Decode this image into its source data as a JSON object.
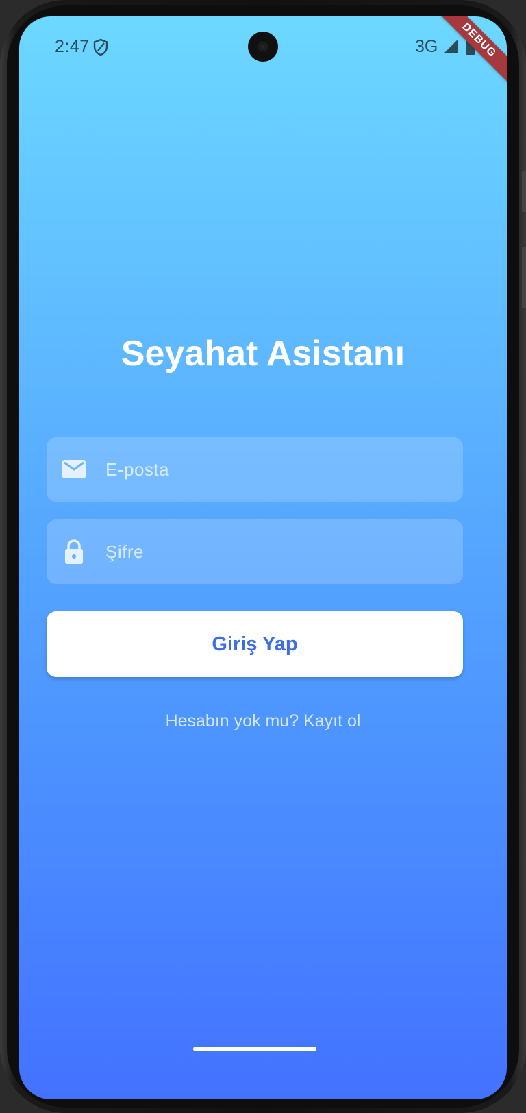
{
  "status_bar": {
    "time": "2:47",
    "network": "3G",
    "shield_icon": "shield-icon",
    "signal_icon": "signal-icon",
    "battery_icon": "battery-icon"
  },
  "debug_banner": "DEBUG",
  "app": {
    "title": "Seyahat Asistanı"
  },
  "login_form": {
    "email": {
      "placeholder": "E-posta",
      "value": "",
      "icon": "email-icon"
    },
    "password": {
      "placeholder": "Şifre",
      "value": "",
      "icon": "lock-icon"
    },
    "submit_label": "Giriş Yap",
    "register_link": "Hesabın yok mu? Kayıt ol"
  },
  "colors": {
    "gradient_top": "#6cd8ff",
    "gradient_bottom": "#4372ff",
    "button_text": "#3d6ee8",
    "debug_banner": "#a5393d"
  }
}
